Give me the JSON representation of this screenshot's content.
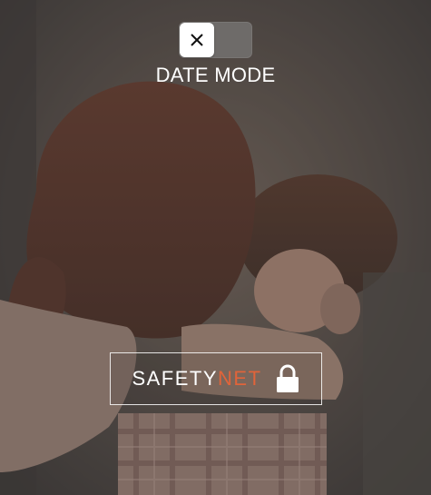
{
  "toggle": {
    "state": "off",
    "knob_icon": "close-icon",
    "label": "DATE MODE"
  },
  "safetynet_button": {
    "label_part1": "SAFETY",
    "label_part2": "NET",
    "accent_color": "#e0643a",
    "icon": "lock-icon"
  },
  "background": {
    "image": "couple-embrace-photo",
    "overlay_color": "#3c3a38"
  }
}
